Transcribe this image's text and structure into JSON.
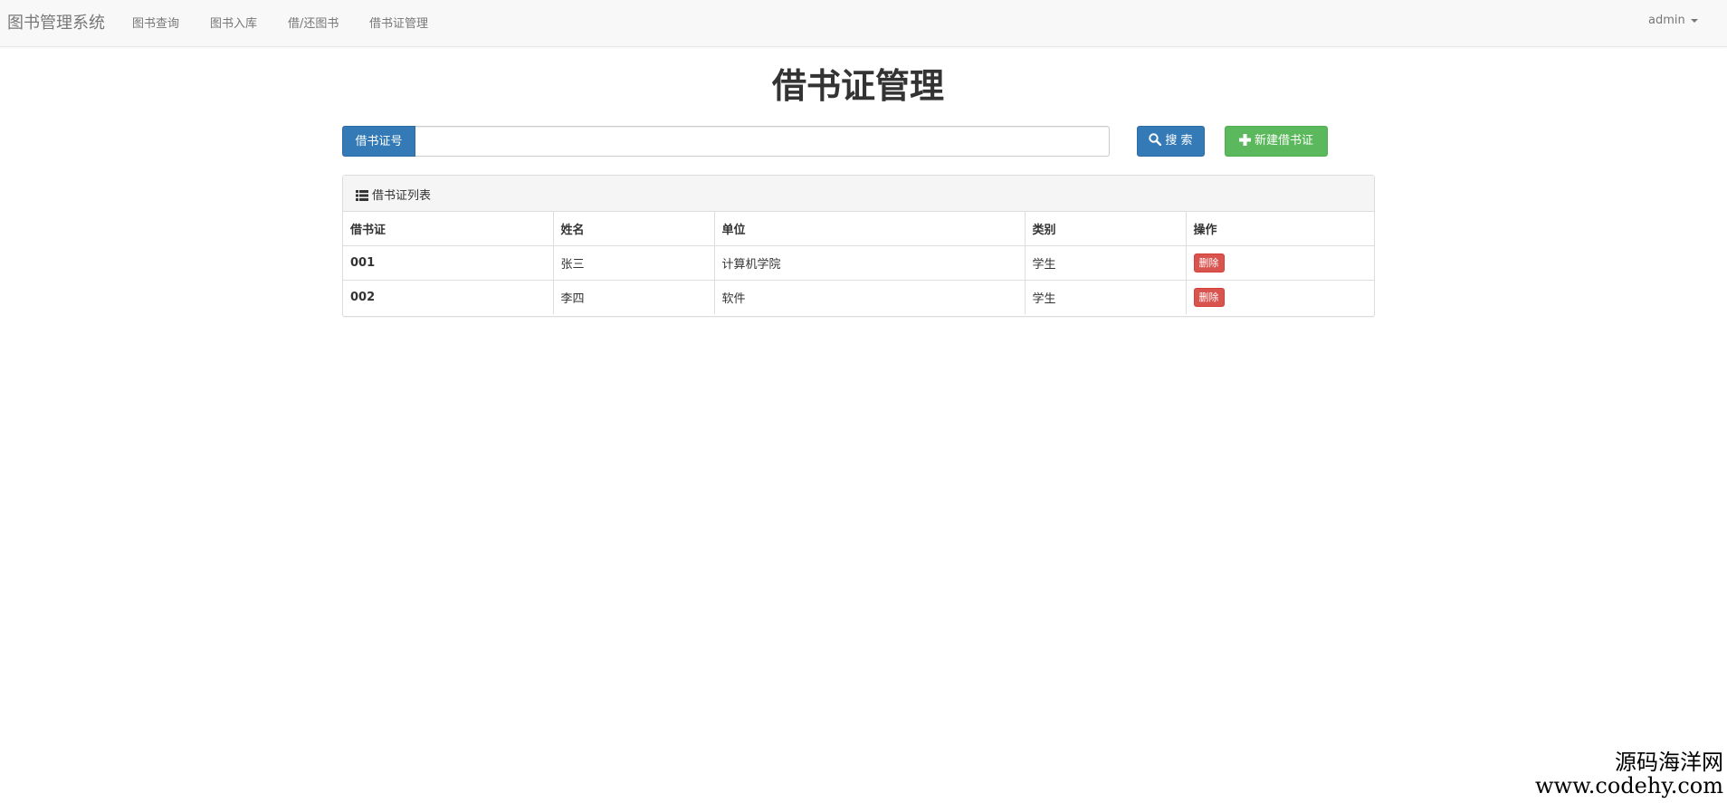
{
  "navbar": {
    "brand": "图书管理系统",
    "items": [
      {
        "label": "图书查询"
      },
      {
        "label": "图书入库"
      },
      {
        "label": "借/还图书"
      },
      {
        "label": "借书证管理"
      }
    ],
    "user": "admin"
  },
  "page": {
    "title": "借书证管理"
  },
  "search": {
    "addon_label": "借书证号",
    "value": "",
    "placeholder": "",
    "search_button": "搜 索",
    "new_button": "新建借书证"
  },
  "panel": {
    "heading": "借书证列表",
    "heading_icon": "list-icon"
  },
  "table": {
    "columns": [
      "借书证",
      "姓名",
      "单位",
      "类别",
      "操作"
    ],
    "rows": [
      {
        "id": "001",
        "name": "张三",
        "unit": "计算机学院",
        "category": "学生",
        "action": "删除"
      },
      {
        "id": "002",
        "name": "李四",
        "unit": "软件",
        "category": "学生",
        "action": "删除"
      }
    ]
  },
  "watermark": {
    "line1": "源码海洋网",
    "line2": "www.codehy.com"
  },
  "colors": {
    "primary": "#337ab7",
    "success": "#5cb85c",
    "danger": "#d9534f",
    "navbar_bg": "#f8f8f8"
  }
}
